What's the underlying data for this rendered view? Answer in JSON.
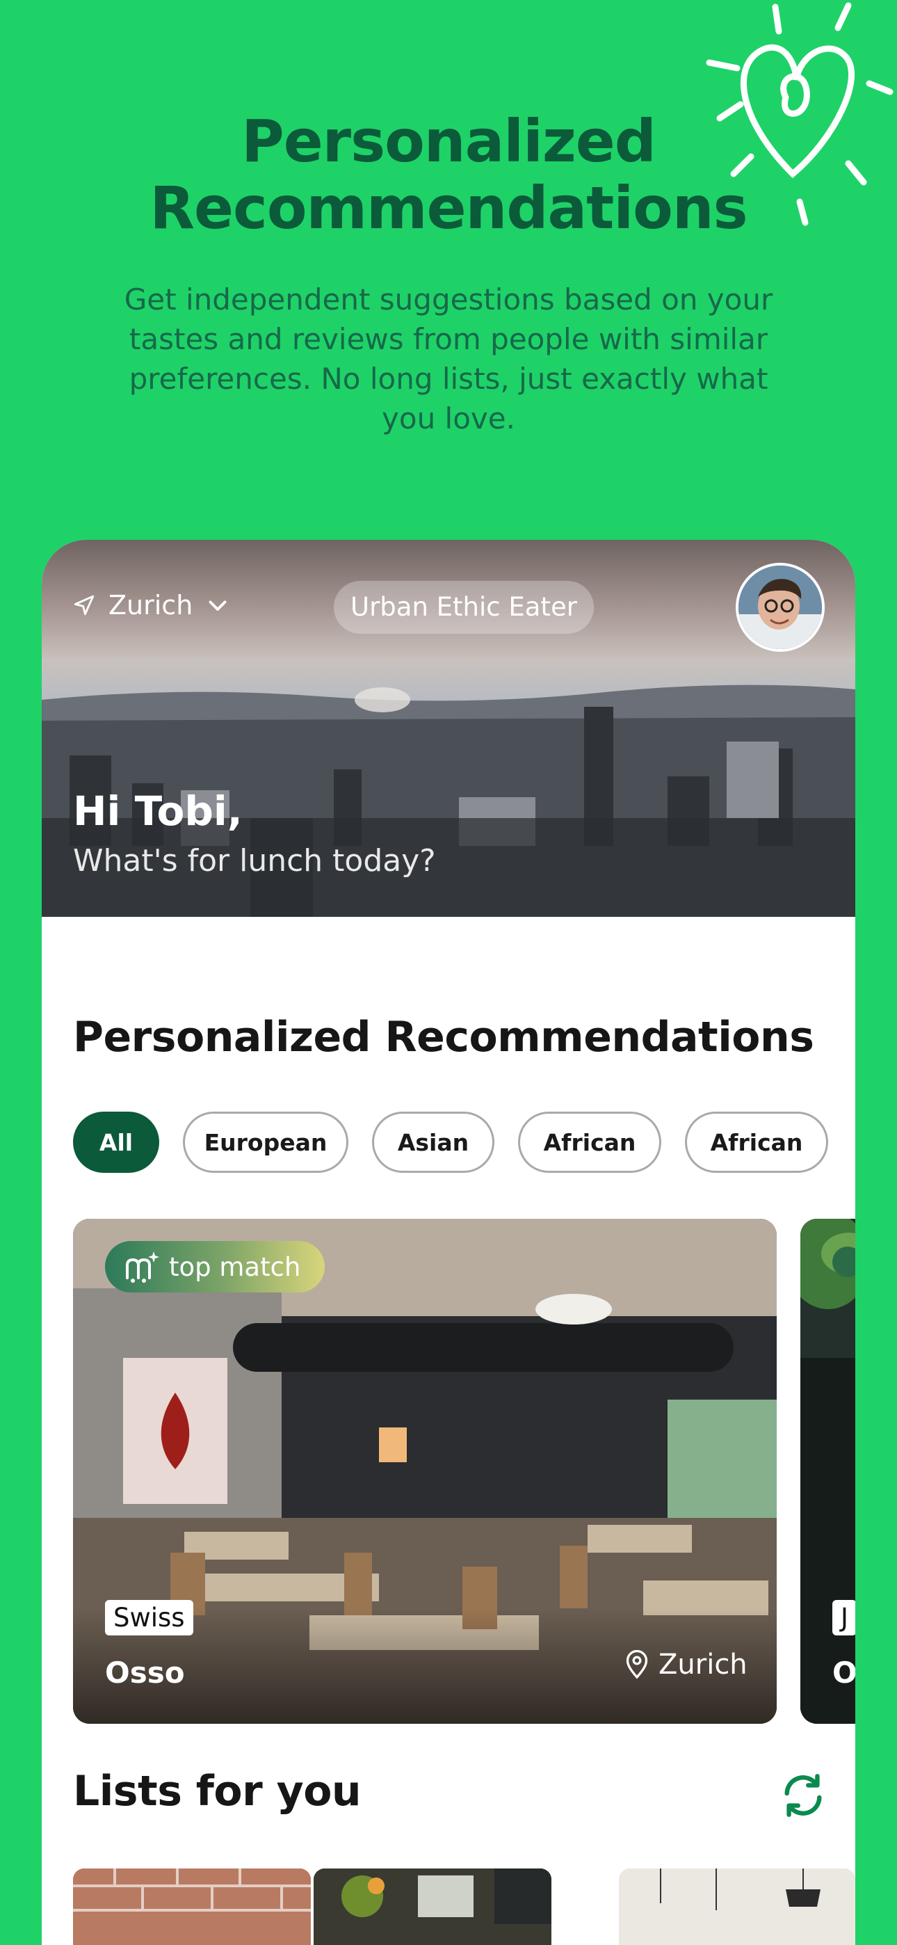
{
  "promo": {
    "title_line1": "Personalized",
    "title_line2": "Recommendations",
    "subtitle": "Get independent suggestions based on your tastes and reviews from people with similar preferences. No long lists, just exactly what you love."
  },
  "header": {
    "location": "Zurich",
    "profile_pill": "Urban Ethic Eater",
    "greeting": "Hi Tobi,",
    "greeting_sub": "What's for lunch today?"
  },
  "recommendations": {
    "section_title": "Personalized Recommendations",
    "chips": [
      "All",
      "European",
      "Asian",
      "African",
      "African"
    ],
    "active_chip": "All",
    "cards": [
      {
        "badge": "top match",
        "cuisine": "Swiss",
        "name": "Osso",
        "location": "Zurich"
      },
      {
        "cuisine": "J",
        "name": "O"
      }
    ]
  },
  "lists": {
    "section_title": "Lists for you"
  },
  "colors": {
    "background": "#1ED268",
    "brand_dark": "#0B5A3A"
  }
}
